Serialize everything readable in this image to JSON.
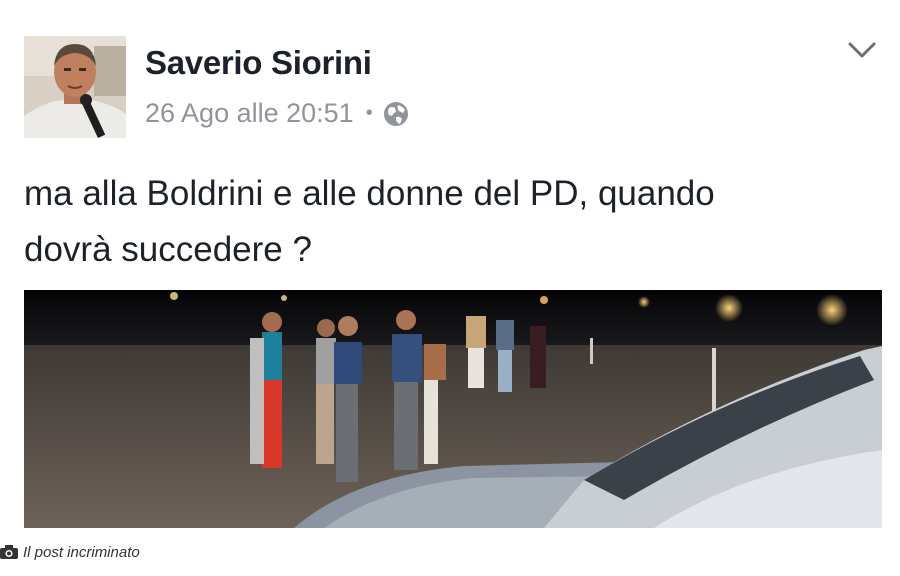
{
  "post": {
    "author": "Saverio Siorini",
    "timestamp": "26 Ago alle 20:51",
    "separator": "•",
    "privacy_icon": "globe-icon",
    "menu_icon": "chevron-down-icon",
    "text_line1": "ma alla Boldrini e alle donne del PD, quando",
    "text_line2": "dovrà succedere ?"
  },
  "caption": {
    "icon": "camera-icon",
    "text": "Il post incriminato"
  },
  "colors": {
    "author": "#1d2129",
    "meta": "#90949c",
    "photo_bg": "#0e0e12"
  }
}
